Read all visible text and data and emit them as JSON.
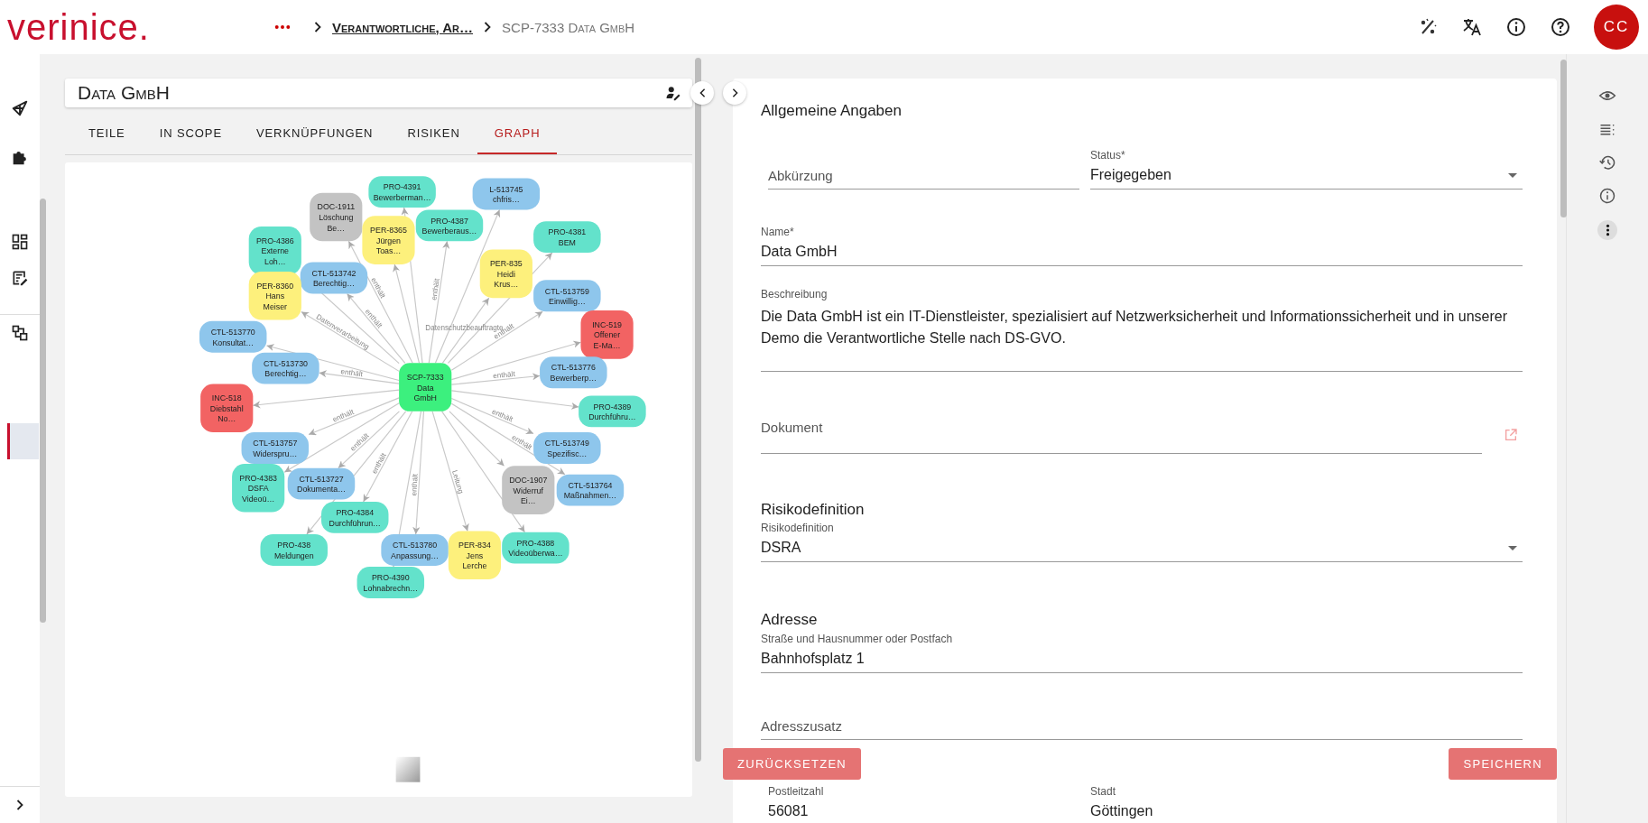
{
  "app": {
    "logo": "verinice.",
    "breadcrumb": [
      {
        "text": "Verantwortliche, Ar…",
        "link": true
      },
      {
        "text": "SCP-7333 Data GmbH",
        "link": false
      }
    ],
    "avatar": "CC"
  },
  "sidebar": {
    "items": [
      {
        "selected": false
      },
      {
        "selected": false
      },
      {
        "selected": false
      },
      {
        "selected": false
      },
      {
        "selected": false
      },
      {
        "selected": true
      }
    ]
  },
  "object": {
    "title": "Data GmbH"
  },
  "tabs": [
    {
      "label": "TEILE",
      "selected": false
    },
    {
      "label": "IN SCOPE",
      "selected": false
    },
    {
      "label": "VERKNÜPFUNGEN",
      "selected": false
    },
    {
      "label": "RISIKEN",
      "selected": false
    },
    {
      "label": "GRAPH",
      "selected": true
    }
  ],
  "graph": {
    "center": {
      "lines": [
        "SCP-7333",
        "Data",
        "GmbH"
      ],
      "color": "#3cf07e"
    },
    "nodes": [
      {
        "lines": [
          "PRO-4391",
          "Bewerberman…"
        ],
        "color": "#63e2cb"
      },
      {
        "lines": [
          "L-513745",
          "chfris…"
        ],
        "color": "#8ec6ec"
      },
      {
        "lines": [
          "DOC-1911",
          "Löschung",
          "Be…"
        ],
        "color": "#c3c3c3",
        "edge_label": "enthält"
      },
      {
        "lines": [
          "PRO-4387",
          "Bewerberaus…"
        ],
        "color": "#63e2cb",
        "edge_label": "enthält"
      },
      {
        "lines": [
          "PER-8365",
          "Jürgen",
          "Toas…"
        ],
        "color": "#fdf07c"
      },
      {
        "lines": [
          "PRO-4381",
          "BEM"
        ],
        "color": "#63e2cb"
      },
      {
        "lines": [
          "PRO-4386",
          "Externe",
          "Loh…"
        ],
        "color": "#63e2cb"
      },
      {
        "lines": [
          "CTL-513742",
          "Berechtig…"
        ],
        "color": "#8ec6ec",
        "edge_label": "enthält"
      },
      {
        "lines": [
          "PER-835",
          "Heidi",
          "Krus…"
        ],
        "color": "#fdf07c",
        "edge_label": "Datenschutzbeauftragte"
      },
      {
        "lines": [
          "PER-8360",
          "Hans",
          "Meiser"
        ],
        "color": "#fdf07c",
        "edge_label": "Datenverarbeitung"
      },
      {
        "lines": [
          "CTL-513759",
          "Einwillig…"
        ],
        "color": "#8ec6ec",
        "edge_label": "enthält"
      },
      {
        "lines": [
          "CTL-513770",
          "Konsultat…"
        ],
        "color": "#8ec6ec"
      },
      {
        "lines": [
          "INC-519",
          "Offener",
          "E-Ma…"
        ],
        "color": "#f26363"
      },
      {
        "lines": [
          "CTL-513730",
          "Berechtig…"
        ],
        "color": "#8ec6ec",
        "edge_label": "enthält"
      },
      {
        "lines": [
          "CTL-513776",
          "Bewerberp…"
        ],
        "color": "#8ec6ec",
        "edge_label": "enthält"
      },
      {
        "lines": [
          "INC-518",
          "Diebstahl",
          "No…"
        ],
        "color": "#f26363"
      },
      {
        "lines": [
          "PRO-4389",
          "Durchführu…"
        ],
        "color": "#63e2cb"
      },
      {
        "lines": [
          "CTL-513757",
          "Widerspru…"
        ],
        "color": "#8ec6ec",
        "edge_label": "enthält"
      },
      {
        "lines": [
          "CTL-513749",
          "Spezifisc…"
        ],
        "color": "#8ec6ec",
        "edge_label": "enthält"
      },
      {
        "lines": [
          "PRO-4383",
          "DSFA",
          "Videoü…"
        ],
        "color": "#63e2cb"
      },
      {
        "lines": [
          "CTL-513727",
          "Dokumenta…"
        ],
        "color": "#8ec6ec",
        "edge_label": "enthält"
      },
      {
        "lines": [
          "DOC-1907",
          "Widerruf",
          "Ei…"
        ],
        "color": "#c3c3c3"
      },
      {
        "lines": [
          "CTL-513764",
          "Maßnahmen…"
        ],
        "color": "#8ec6ec",
        "edge_label": "enthält"
      },
      {
        "lines": [
          "PRO-4384",
          "Durchführun…"
        ],
        "color": "#63e2cb",
        "edge_label": "enthält"
      },
      {
        "lines": [
          "PRO-438",
          "Meldungen"
        ],
        "color": "#63e2cb"
      },
      {
        "lines": [
          "CTL-513780",
          "Anpassung…"
        ],
        "color": "#8ec6ec",
        "edge_label": "enthält"
      },
      {
        "lines": [
          "PER-834",
          "Jens",
          "Lerche"
        ],
        "color": "#fdf07c",
        "edge_label": "Leitung"
      },
      {
        "lines": [
          "PRO-4388",
          "Videoüberwa…"
        ],
        "color": "#63e2cb"
      },
      {
        "lines": [
          "PRO-4390",
          "Lohnabrechn…"
        ],
        "color": "#63e2cb"
      }
    ]
  },
  "form": {
    "blocks": [
      {
        "kind": "heading",
        "text": "Allgemeine Angaben"
      },
      {
        "kind": "row",
        "fields": [
          {
            "kind": "text",
            "label": "Abkürzung"
          },
          {
            "kind": "select",
            "label": "Status*",
            "value": "Freigegeben"
          }
        ]
      },
      {
        "kind": "row",
        "fields": [
          {
            "kind": "text",
            "label": "Name*",
            "value": "Data GmbH"
          }
        ]
      },
      {
        "kind": "row",
        "fields": [
          {
            "kind": "textarea",
            "label": "Beschreibung",
            "value": "Die Data GmbH ist ein IT-Dienstleister, spezialisiert auf Netzwerksicherheit und Informationssicherheit und in unserer Demo die Verantwortliche Stelle nach DS-GVO."
          }
        ]
      },
      {
        "kind": "row",
        "fields": [
          {
            "kind": "document",
            "label": "Dokument"
          }
        ]
      },
      {
        "kind": "heading",
        "text": "Risikodefinition"
      },
      {
        "kind": "row",
        "fields": [
          {
            "kind": "select",
            "label": "Risikodefinition",
            "value": "DSRA"
          }
        ]
      },
      {
        "kind": "heading",
        "text": "Adresse"
      },
      {
        "kind": "row",
        "fields": [
          {
            "kind": "text",
            "label": "Straße und Hausnummer oder Postfach",
            "value": "Bahnhofsplatz 1"
          }
        ]
      },
      {
        "kind": "row",
        "fields": [
          {
            "kind": "text",
            "label": "Adresszusatz"
          }
        ]
      },
      {
        "kind": "row",
        "fields": [
          {
            "kind": "text",
            "label": "Postleitzahl",
            "value": "56081"
          },
          {
            "kind": "text",
            "label": "Stadt",
            "value": "Göttingen"
          }
        ]
      }
    ],
    "buttons": [
      {
        "label": "ZURÜCKSETZEN",
        "disabled": true
      },
      {
        "label": "SPEICHERN",
        "disabled": true
      }
    ]
  }
}
